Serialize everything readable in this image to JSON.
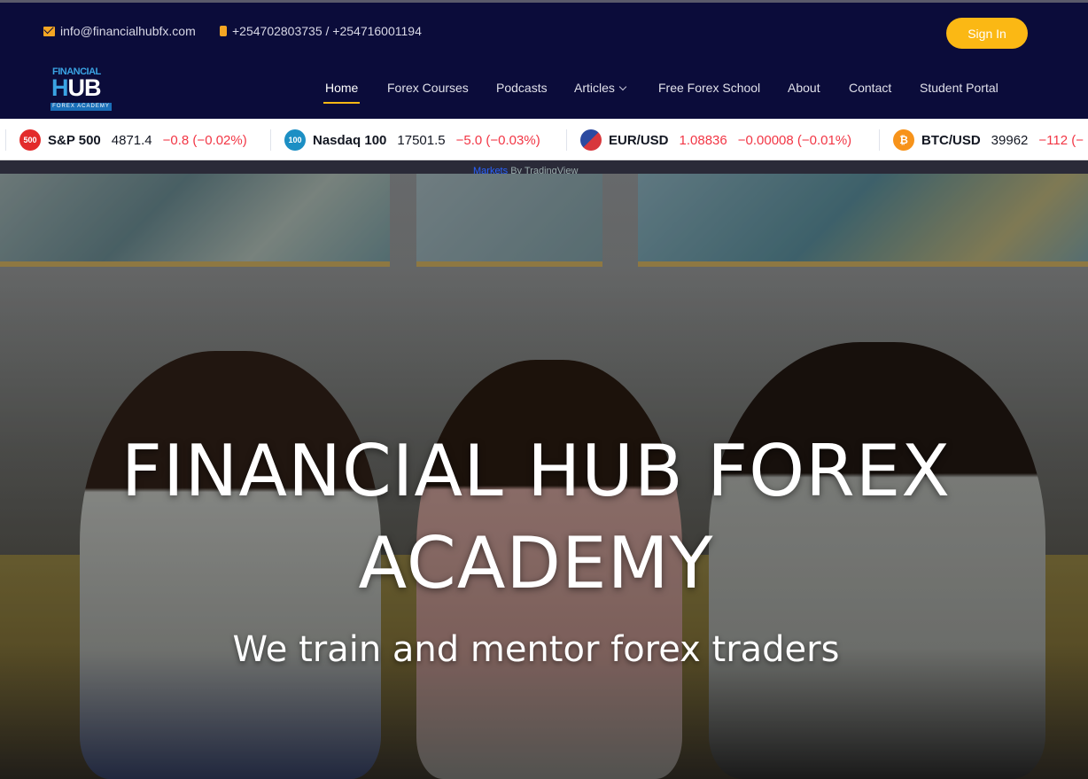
{
  "topbar": {
    "email": "info@financialhubfx.com",
    "phone": "+254702803735 / +254716001194",
    "signin_label": "Sign In"
  },
  "logo": {
    "line1": "FINANCIAL",
    "line2a": "H",
    "line2b": "UB",
    "line3": "FOREX ACADEMY"
  },
  "nav": {
    "items": [
      {
        "label": "Home",
        "active": true
      },
      {
        "label": "Forex Courses"
      },
      {
        "label": "Podcasts"
      },
      {
        "label": "Articles"
      },
      {
        "label": "Free Forex School"
      },
      {
        "label": "About"
      },
      {
        "label": "Contact"
      },
      {
        "label": "Student Portal"
      }
    ]
  },
  "ticker": {
    "items": [
      {
        "badge": "500",
        "symbol": "S&P 500",
        "price": "4871.4",
        "change": "−0.8 (−0.02%)",
        "badge_color": "#e32b2b"
      },
      {
        "badge": "100",
        "symbol": "Nasdaq 100",
        "price": "17501.5",
        "change": "−5.0 (−0.03%)",
        "badge_color": "#1c8fc4"
      },
      {
        "badge": "",
        "symbol": "EUR/USD",
        "price": "1.08836",
        "change": "−0.00008 (−0.01%)",
        "badge_color": "#2c4aa0"
      },
      {
        "badge": "₿",
        "symbol": "BTC/USD",
        "price": "39962",
        "change": "−112 (−",
        "badge_color": "#f7931a"
      }
    ],
    "attribution_link": "Markets",
    "attribution_text": "By TradingView"
  },
  "hero": {
    "title": "FINANCIAL HUB FOREX ACADEMY",
    "subtitle": "We train and mentor forex traders"
  },
  "colors": {
    "header_bg": "#0b0c3a",
    "accent": "#fbb814",
    "negative": "#f23645"
  }
}
